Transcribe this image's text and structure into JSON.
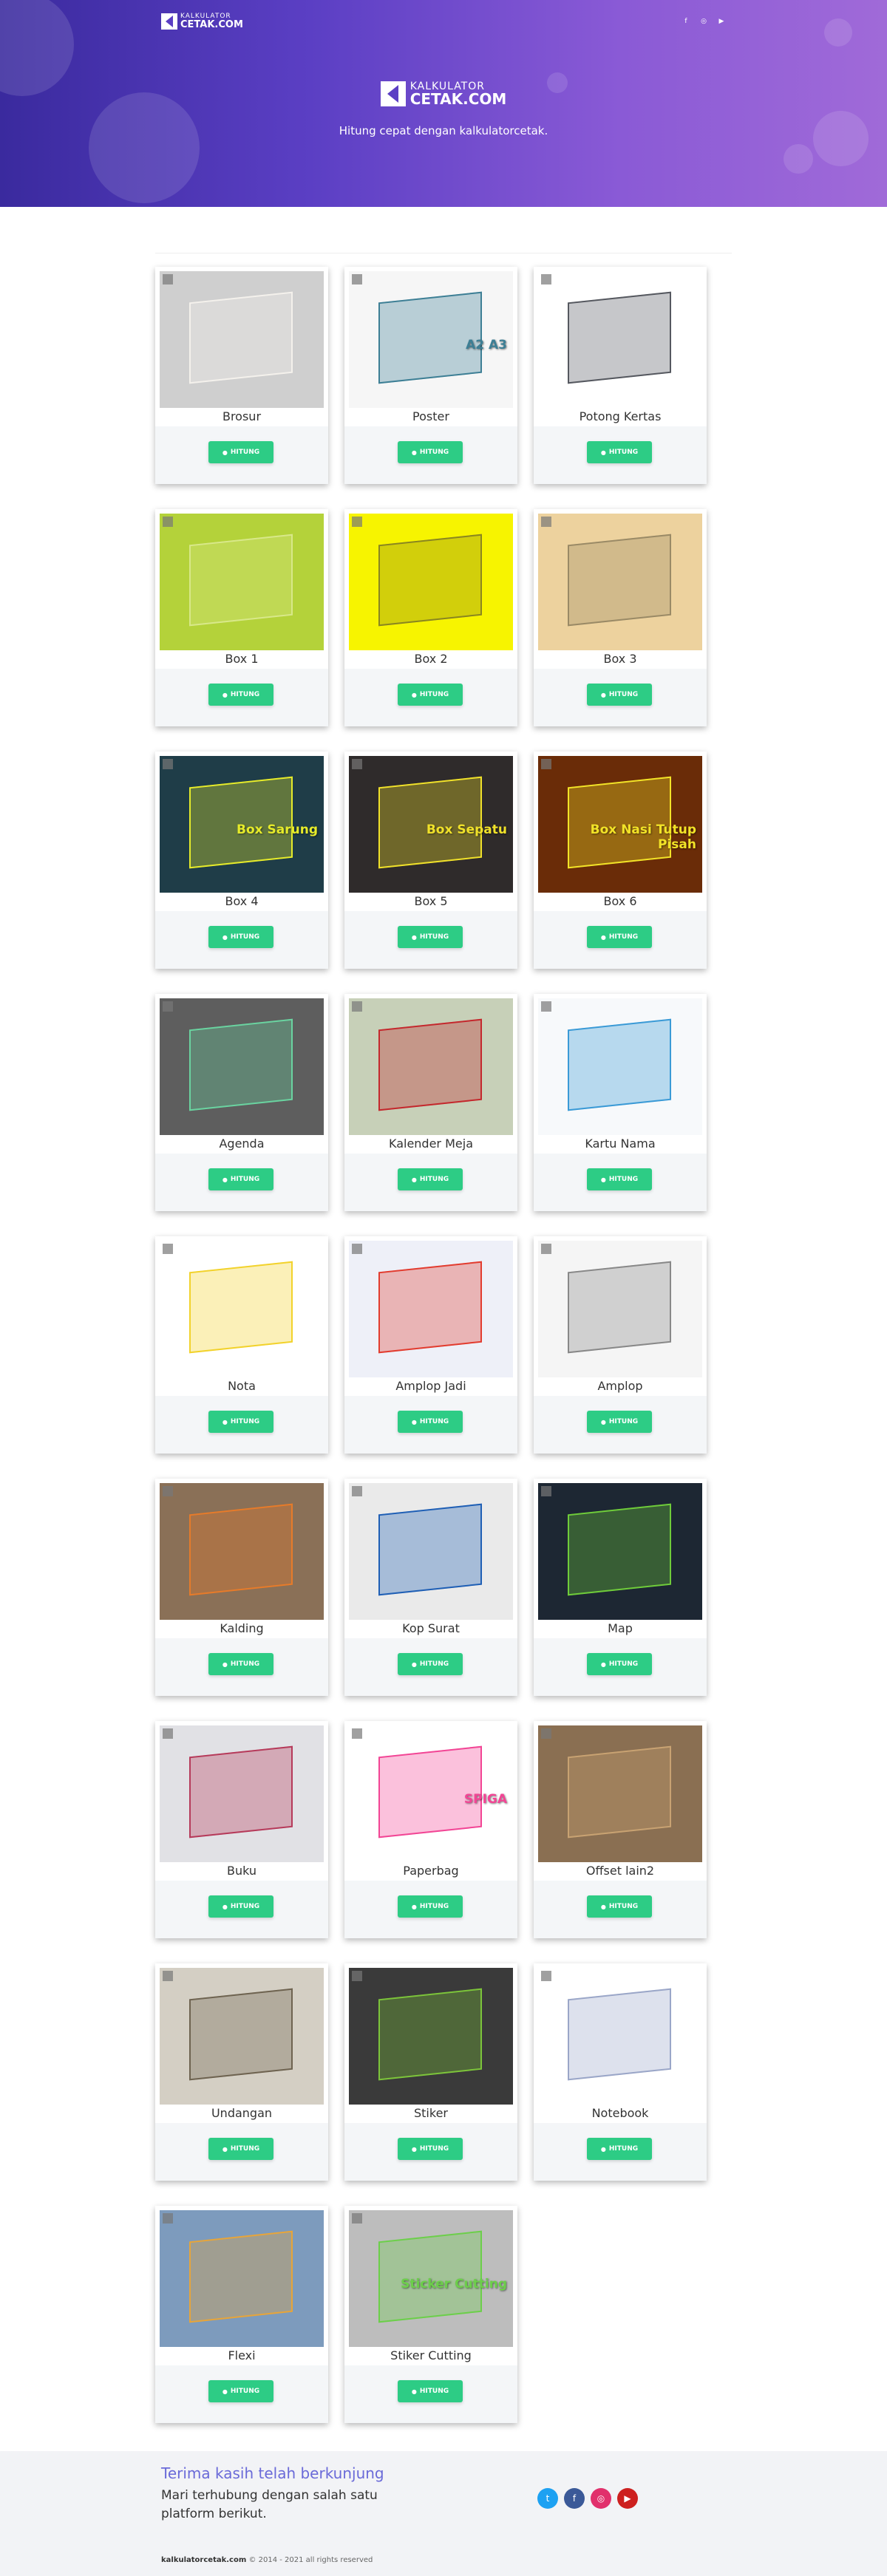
{
  "brand": {
    "line1": "KALKULATOR",
    "line2": "CETAK.COM"
  },
  "hero": {
    "tagline": "Hitung cepat dengan kalkulatorcetak."
  },
  "colors": {
    "accent": "#2dcc85",
    "header_start": "#3a2a9e",
    "header_end": "#a06ad8"
  },
  "button_label": "HITUNG",
  "cards": [
    {
      "title": "Brosur",
      "bg": "#cfcfcf",
      "fg": "#f4f1ec"
    },
    {
      "title": "Poster",
      "bg": "#f6f6f6",
      "fg": "#3d7f95",
      "overlay": "A2 A3"
    },
    {
      "title": "Potong Kertas",
      "bg": "#ffffff",
      "fg": "#55585f"
    },
    {
      "title": "Box 1",
      "bg": "#b4d23a",
      "fg": "#d8e889"
    },
    {
      "title": "Box 2",
      "bg": "#f7f400",
      "fg": "#8a8620"
    },
    {
      "title": "Box 3",
      "bg": "#edd29e",
      "fg": "#9a8a66"
    },
    {
      "title": "Box 4",
      "bg": "#1f3d48",
      "fg": "#e6eb2a",
      "overlay": "Box Sarung"
    },
    {
      "title": "Box 5",
      "bg": "#2f2b2b",
      "fg": "#f0e12a",
      "overlay": "Box Sepatu"
    },
    {
      "title": "Box 6",
      "bg": "#6a2c08",
      "fg": "#f2e327",
      "overlay": "Box Nasi Tutup Pisah"
    },
    {
      "title": "Agenda",
      "bg": "#5e5e5e",
      "fg": "#6ad3a0"
    },
    {
      "title": "Kalender Meja",
      "bg": "#c7d0b8",
      "fg": "#c4282d"
    },
    {
      "title": "Kartu Nama",
      "bg": "#f7f9fb",
      "fg": "#3a9ad6"
    },
    {
      "title": "Nota",
      "bg": "#ffffff",
      "fg": "#f2d22b"
    },
    {
      "title": "Amplop Jadi",
      "bg": "#eef0f8",
      "fg": "#e23c2f"
    },
    {
      "title": "Amplop",
      "bg": "#f5f5f5",
      "fg": "#888888"
    },
    {
      "title": "Kalding",
      "bg": "#8a7057",
      "fg": "#e67b2a"
    },
    {
      "title": "Kop Surat",
      "bg": "#eaeaea",
      "fg": "#1f5fb5"
    },
    {
      "title": "Map",
      "bg": "#1d2733",
      "fg": "#6fcc3a"
    },
    {
      "title": "Buku",
      "bg": "#e1e1e5",
      "fg": "#b63a5a"
    },
    {
      "title": "Paperbag",
      "bg": "#ffffff",
      "fg": "#f24595",
      "overlay": "SPIGA"
    },
    {
      "title": "Offset lain2",
      "bg": "#8a6f52",
      "fg": "#c8a272"
    },
    {
      "title": "Undangan",
      "bg": "#d4cfc4",
      "fg": "#6e6350"
    },
    {
      "title": "Stiker",
      "bg": "#3a3a3a",
      "fg": "#7cc43a"
    },
    {
      "title": "Notebook",
      "bg": "#ffffff",
      "fg": "#9aa6c8"
    },
    {
      "title": "Flexi",
      "bg": "#7d9bbd",
      "fg": "#e7a53a"
    },
    {
      "title": "Stiker Cutting",
      "bg": "#bdbdbd",
      "fg": "#6ccf4a",
      "overlay": "Sticker Cutting"
    }
  ],
  "footer": {
    "title": "Terima kasih telah berkunjung",
    "subtitle": "Mari terhubung dengan salah satu platform berikut.",
    "copyright_site": "kalkulatorcetak.com",
    "copyright_rest": "© 2014 - 2021 all rights reserved",
    "social_icons": [
      "twitter-icon",
      "facebook-icon",
      "instagram-icon",
      "youtube-icon"
    ]
  }
}
